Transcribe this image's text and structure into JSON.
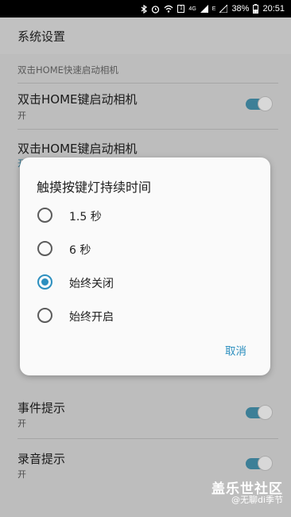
{
  "status_bar": {
    "icons": [
      "bluetooth-icon",
      "alarm-icon",
      "wifi-icon",
      "sim-icon",
      "signal-icon",
      "signal-icon-2"
    ],
    "sim_label": "1",
    "network_label": "4G",
    "e_label": "E",
    "battery": "38%",
    "time": "20:51"
  },
  "app_bar": {
    "title": "系统设置"
  },
  "section_1": {
    "header": "双击HOME快速启动相机"
  },
  "items": [
    {
      "title": "双击HOME键启动相机",
      "sub": "开",
      "toggle": true
    },
    {
      "title": "双击HOME键启动相机",
      "sub": "开"
    },
    {
      "title": "触摸按键灯持续时间",
      "sub": ""
    },
    {
      "title": "",
      "sub": ""
    },
    {
      "title": "",
      "sub": ""
    },
    {
      "title": "事件提示",
      "sub": "开",
      "toggle": true
    },
    {
      "title": "录音提示",
      "sub": "开",
      "toggle": true
    }
  ],
  "dialog": {
    "title": "触摸按键灯持续时间",
    "options": [
      {
        "label": "1.5 秒",
        "checked": false
      },
      {
        "label": "6 秒",
        "checked": false
      },
      {
        "label": "始终关闭",
        "checked": true
      },
      {
        "label": "始终开启",
        "checked": false
      }
    ],
    "cancel_label": "取消"
  },
  "watermark": {
    "line1": "盖乐世社区",
    "line2": "@无聊di季节"
  },
  "colors": {
    "accent": "#2c8fbf",
    "toggle_on": "#3d7f97"
  }
}
